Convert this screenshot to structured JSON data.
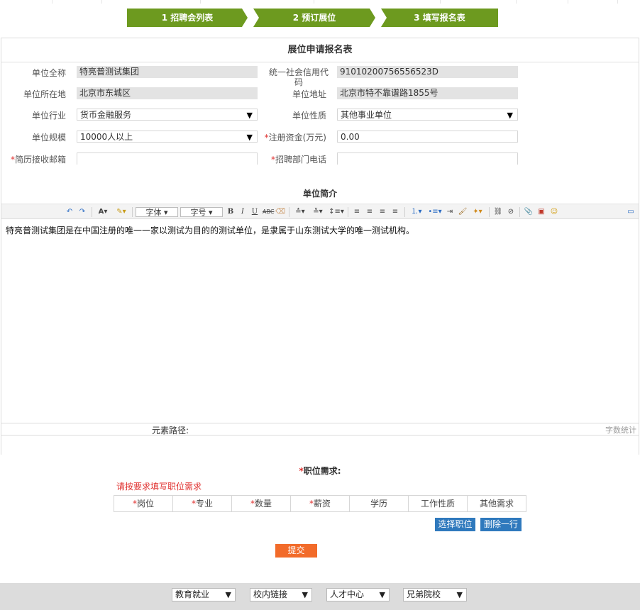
{
  "steps": [
    "1  招聘会列表",
    "2  预订展位",
    "3  填写报名表"
  ],
  "form": {
    "title": "展位申请报名表",
    "full_name_label": "单位全称",
    "full_name_value": "特亮普测试集团",
    "credit_code_label": "统一社会信用代码",
    "credit_code_value": "91010200756556523D",
    "location_label": "单位所在地",
    "location_value": "北京市东城区",
    "address_label": "单位地址",
    "address_value": "北京市特不靠谱路1855号",
    "industry_label": "单位行业",
    "industry_value": "货币金融服务",
    "nature_label": "单位性质",
    "nature_value": "其他事业单位",
    "scale_label": "单位规模",
    "scale_value": "10000人以上",
    "capital_label": "注册资金(万元)",
    "capital_value": "0.00",
    "email_label": "简历接收邮箱",
    "email_value": "",
    "phone_label": "招聘部门电话",
    "phone_value": ""
  },
  "intro": {
    "title": "单位简介",
    "font_label": "字体",
    "size_label": "字号",
    "content": "特亮普测试集团是在中国注册的唯一一家以测试为目的的测试单位，是隶属于山东测试大学的唯一测试机构。",
    "path_label": "元素路径:",
    "count_label": "字数统计"
  },
  "jobs": {
    "title": "职位需求:",
    "hint": "请按要求填写职位需求",
    "columns": [
      {
        "label": "岗位",
        "required": true
      },
      {
        "label": "专业",
        "required": true
      },
      {
        "label": "数量",
        "required": true
      },
      {
        "label": "薪资",
        "required": true
      },
      {
        "label": "学历",
        "required": false
      },
      {
        "label": "工作性质",
        "required": false
      },
      {
        "label": "其他需求",
        "required": false
      }
    ],
    "select_button": "选择职位",
    "delete_button": "删除一行",
    "submit_button": "提交"
  },
  "footer": {
    "links": [
      "教育就业",
      "校内链接",
      "人才中心",
      "兄弟院校"
    ]
  },
  "colors": {
    "step_green": "#6d9a1f",
    "required_red": "#e0312f",
    "button_blue": "#2f79bd",
    "submit_orange": "#f26b2a"
  }
}
